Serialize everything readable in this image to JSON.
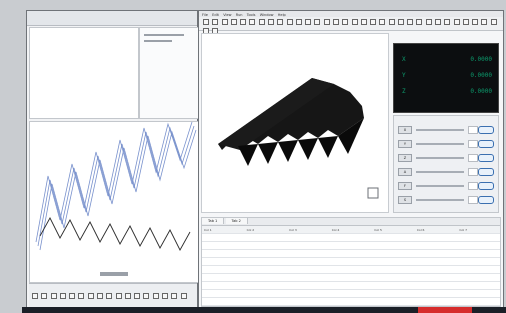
{
  "left_monitor": {
    "title": "",
    "grid_rows": 26,
    "bottom_tools": [
      "icon-1",
      "icon-2",
      "icon-3",
      "icon-4",
      "icon-5",
      "icon-6",
      "icon-7",
      "icon-8",
      "icon-9",
      "icon-10",
      "icon-11",
      "icon-12",
      "icon-13",
      "icon-14",
      "icon-15",
      "icon-16",
      "icon-17"
    ]
  },
  "right_monitor": {
    "menu": [
      "File",
      "Edit",
      "View",
      "Run",
      "Tools",
      "Window",
      "Help"
    ],
    "toolbar_icons": 34,
    "dro": {
      "rows": [
        {
          "axis": "X",
          "value": "0.0000"
        },
        {
          "axis": "Y",
          "value": "0.0000"
        },
        {
          "axis": "Z",
          "value": "0.0000"
        }
      ]
    },
    "controls": {
      "rows": [
        {
          "label": "X"
        },
        {
          "label": "Y"
        },
        {
          "label": "Z"
        },
        {
          "label": "A"
        },
        {
          "label": "F"
        },
        {
          "label": "S"
        }
      ]
    },
    "table": {
      "tabs": [
        "Tab 1",
        "Tab 2"
      ],
      "headers": [
        "Col 1",
        "Col 2",
        "Col 3",
        "Col 4",
        "Col 5",
        "Col 6",
        "Col 7"
      ],
      "rows": [
        [
          "",
          "",
          "",
          "",
          "",
          "",
          ""
        ],
        [
          "",
          "",
          "",
          "",
          "",
          "",
          ""
        ],
        [
          "",
          "",
          "",
          "",
          "",
          "",
          ""
        ],
        [
          "",
          "",
          "",
          "",
          "",
          "",
          ""
        ],
        [
          "",
          "",
          "",
          "",
          "",
          "",
          ""
        ],
        [
          "",
          "",
          "",
          "",
          "",
          "",
          ""
        ],
        [
          "",
          "",
          "",
          "",
          "",
          "",
          ""
        ],
        [
          "",
          "",
          "",
          "",
          "",
          "",
          ""
        ],
        [
          "",
          "",
          "",
          "",
          "",
          "",
          ""
        ],
        [
          "",
          "",
          "",
          "",
          "",
          "",
          ""
        ]
      ]
    }
  },
  "colors": {
    "dro_text": "#0c9b6d",
    "dro_bg": "#0c0e10",
    "button_border": "#3a6fb0",
    "wave_blue": "#6c87c8",
    "wave_dark": "#2b2b2b",
    "part": "#111111",
    "taskbar": "#1b1f27",
    "taskbar_accent": "#d62c2c"
  }
}
